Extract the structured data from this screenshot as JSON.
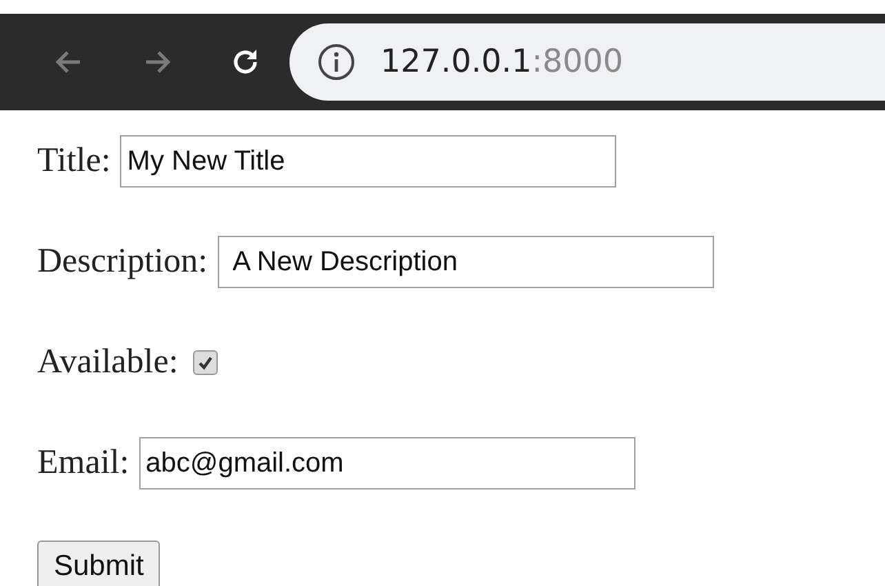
{
  "browser": {
    "host": "127.0.0.1",
    "port": ":8000"
  },
  "fields": [
    {
      "kind": "text",
      "label": "Title:",
      "value": "My New Title"
    },
    {
      "kind": "text",
      "label": "Description:",
      "value": "A New Description"
    },
    {
      "kind": "checkbox",
      "label": "Available:",
      "checked": true
    },
    {
      "kind": "text",
      "label": "Email:",
      "value": "abc@gmail.com"
    }
  ],
  "submit": "Submit"
}
